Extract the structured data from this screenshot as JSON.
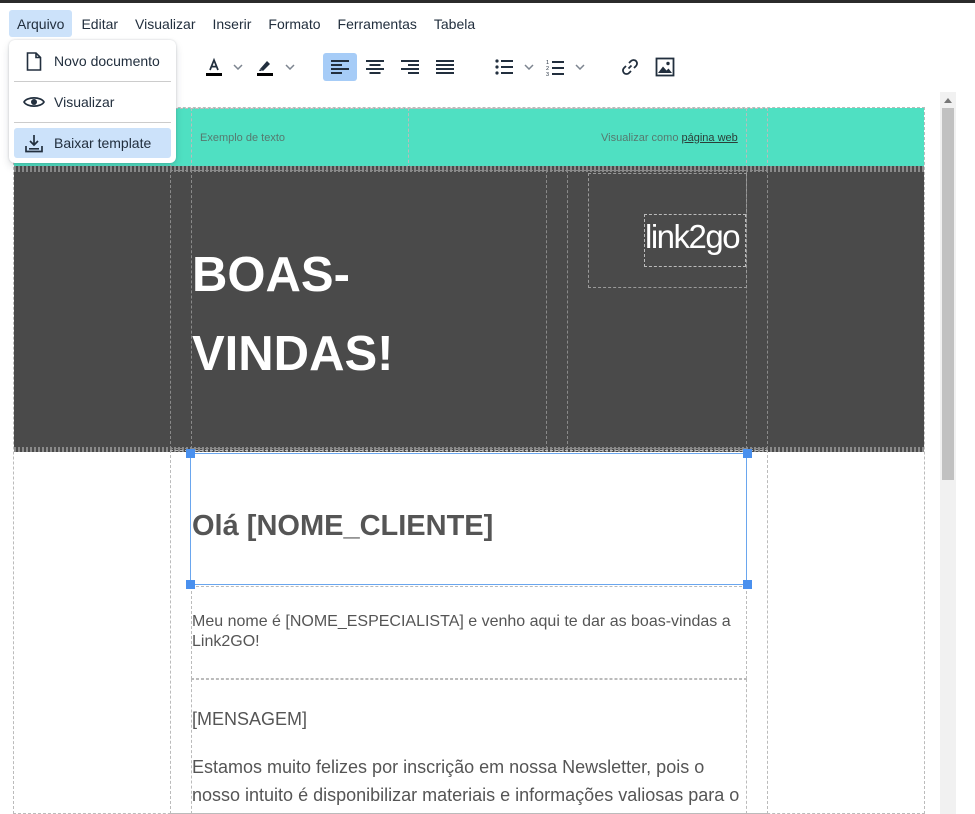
{
  "menubar": {
    "items": [
      {
        "label": "Arquivo"
      },
      {
        "label": "Editar"
      },
      {
        "label": "Visualizar"
      },
      {
        "label": "Inserir"
      },
      {
        "label": "Formato"
      },
      {
        "label": "Ferramentas"
      },
      {
        "label": "Tabela"
      }
    ]
  },
  "dropdown": {
    "items": [
      {
        "label": "Novo documento",
        "icon": "new-document-icon"
      },
      {
        "label": "Visualizar",
        "icon": "eye-icon"
      },
      {
        "label": "Baixar template",
        "icon": "download-icon"
      }
    ]
  },
  "toolbar": {
    "text_color_icon": "text-color-icon",
    "highlight_icon": "highlight-icon",
    "align_left_icon": "align-left-icon",
    "align_center_icon": "align-center-icon",
    "align_right_icon": "align-right-icon",
    "align_justify_icon": "align-justify-icon",
    "bullet_list_icon": "bullet-list-icon",
    "numbered_list_icon": "numbered-list-icon",
    "link_icon": "link-icon",
    "image_icon": "image-icon"
  },
  "email": {
    "preheader_left": "Exemplo de texto",
    "preheader_right_prefix": "Visualizar como ",
    "preheader_right_link": "página web",
    "hero_line1": "BOAS-",
    "hero_line2": "VINDAS!",
    "logo_text": "link2go",
    "greeting": "Olá [NOME_CLIENTE]",
    "intro": "Meu nome é [NOME_ESPECIALISTA] e venho aqui te dar as boas-vindas a Link2GO!",
    "message_placeholder": "[MENSAGEM]",
    "body": "Estamos muito felizes por inscrição em nossa Newsletter, pois o nosso intuito é disponibilizar materiais e informações valiosas para o"
  },
  "colors": {
    "accent": "#4fe0c2",
    "hero_bg": "#4a4a4a",
    "selection": "#4a90ee",
    "menu_active": "#cce2fa",
    "button_active": "#a6ccf7"
  }
}
